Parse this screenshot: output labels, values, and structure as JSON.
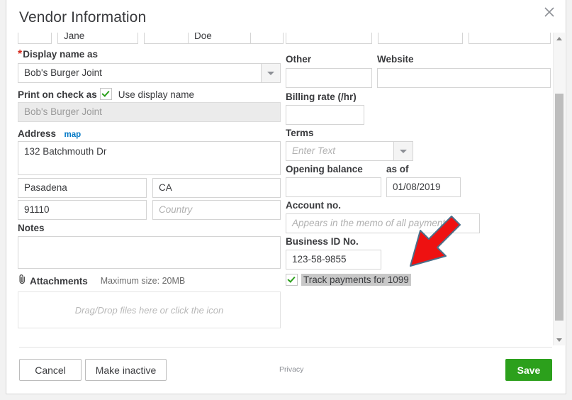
{
  "dialog": {
    "title": "Vendor Information",
    "close_icon": "close-icon"
  },
  "top_row": {
    "left_fields": [
      "",
      "Jane",
      "",
      "Doe",
      ""
    ],
    "right_fields": [
      "",
      "",
      ""
    ]
  },
  "left_column": {
    "display_name": {
      "label": "Display name as",
      "required_marker": "*",
      "value": "Bob's Burger Joint",
      "dropdown_icon": "chevron-down-icon"
    },
    "print_on_check": {
      "label": "Print on check as",
      "checkbox_label": "Use display name",
      "checked": true,
      "value": "Bob's Burger Joint"
    },
    "address": {
      "label": "Address",
      "map_link": "map",
      "street": "132 Batchmouth Dr",
      "city": "Pasadena",
      "state": "CA",
      "zip": "91110",
      "country_placeholder": "Country"
    },
    "notes": {
      "label": "Notes",
      "value": ""
    },
    "attachments": {
      "icon": "paperclip-icon",
      "label": "Attachments",
      "max_size": "Maximum size: 20MB",
      "dropzone_text": "Drag/Drop files here or click the icon"
    }
  },
  "right_column": {
    "other": {
      "label": "Other",
      "value": ""
    },
    "website": {
      "label": "Website",
      "value": ""
    },
    "billing_rate": {
      "label": "Billing rate (/hr)",
      "value": ""
    },
    "terms": {
      "label": "Terms",
      "placeholder": "Enter Text",
      "dropdown_icon": "chevron-down-icon"
    },
    "opening_balance": {
      "label": "Opening balance",
      "value": ""
    },
    "as_of": {
      "label": "as of",
      "value": "01/08/2019"
    },
    "account_no": {
      "label": "Account no.",
      "placeholder": "Appears in the memo of all payments"
    },
    "business_id": {
      "label": "Business ID No.",
      "value": "123-58-9855"
    },
    "track_1099": {
      "label": "Track payments for 1099",
      "checked": true,
      "highlighted": true
    }
  },
  "scrollbar": {
    "up_icon": "scroll-up-arrow-icon",
    "down_icon": "scroll-down-arrow-icon"
  },
  "footer": {
    "cancel": "Cancel",
    "make_inactive": "Make inactive",
    "privacy": "Privacy",
    "save": "Save"
  },
  "annotation": {
    "arrow_icon": "red-arrow-pointing-down-left",
    "color": "#ee1111",
    "outline": "#4a6f8a"
  },
  "colors": {
    "accent_green": "#2ca01c",
    "link_blue": "#0077c5",
    "required_red": "#d52b1e",
    "text": "#393a3d"
  }
}
